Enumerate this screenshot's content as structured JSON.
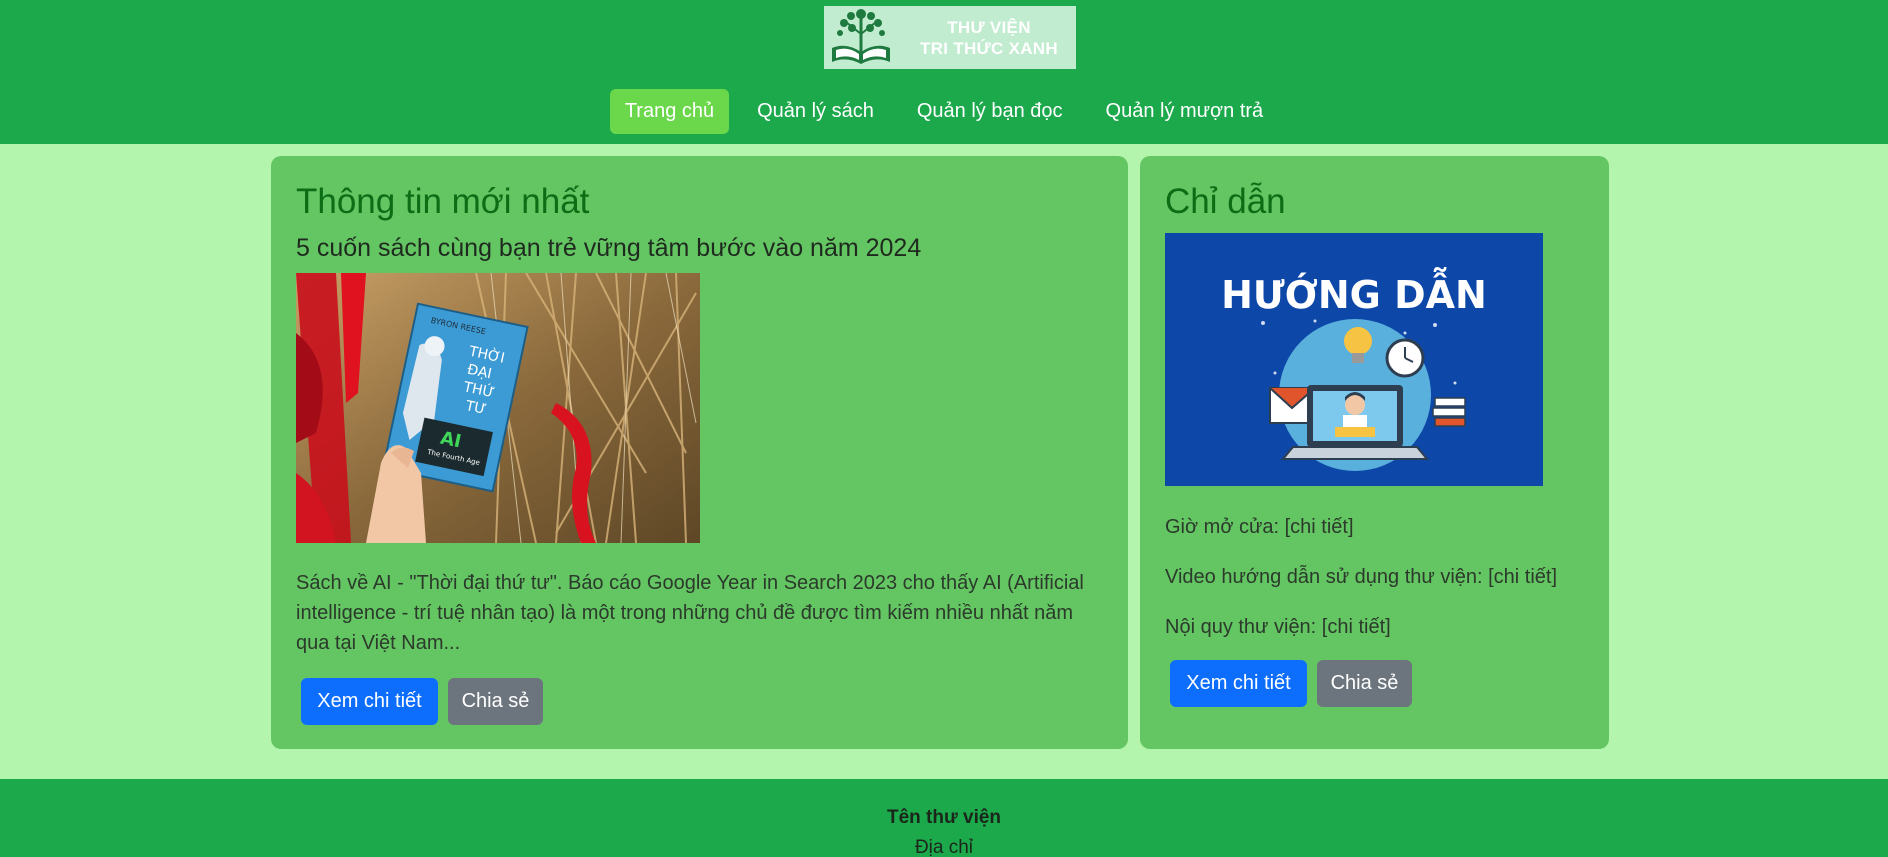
{
  "logo": {
    "line1": "THƯ VIỆN",
    "line2": "TRI THỨC XANH"
  },
  "nav": [
    {
      "label": "Trang chủ",
      "active": true
    },
    {
      "label": "Quản lý sách",
      "active": false
    },
    {
      "label": "Quản lý bạn đọc",
      "active": false
    },
    {
      "label": "Quản lý mượn trả",
      "active": false
    }
  ],
  "news": {
    "heading": "Thông tin mới nhất",
    "article_title": "5 cuốn sách cùng bạn trẻ vững tâm bước vào năm 2024",
    "book_cover": {
      "author": "BYRON REESE",
      "title_lines": [
        "THỜI",
        "ĐẠI",
        "THỨ",
        "TƯ"
      ],
      "ai_label": "AI",
      "subtitle": "The Fourth Age"
    },
    "description": "Sách về AI - \"Thời đại thứ tư\". Báo cáo Google Year in Search 2023 cho thấy AI (Artificial intelligence - trí tuệ nhân tạo) là một trong những chủ đề được tìm kiếm nhiều nhất năm qua tại Việt Nam...",
    "detail_button": "Xem chi tiết",
    "share_button": "Chia sẻ"
  },
  "guide": {
    "heading": "Chỉ dẫn",
    "image_text": "HƯỚNG DẪN",
    "opening_hours": "Giờ mở cửa: [chi tiết]",
    "video_guide": "Video hướng dẫn sử dụng thư viện: [chi tiết]",
    "rules": "Nội quy thư viện: [chi tiết]",
    "detail_button": "Xem chi tiết",
    "share_button": "Chia sẻ"
  },
  "footer": {
    "library_name": "Tên thư viện",
    "address": "Địa chỉ"
  },
  "colors": {
    "header_bg": "#1ca94c",
    "page_bg": "#b3f5ac",
    "card_bg": "#64c563",
    "active_nav": "#6ad84a",
    "heading_green": "#0b6d14",
    "primary_button": "#0d6efd",
    "secondary_button": "#6c757d"
  }
}
